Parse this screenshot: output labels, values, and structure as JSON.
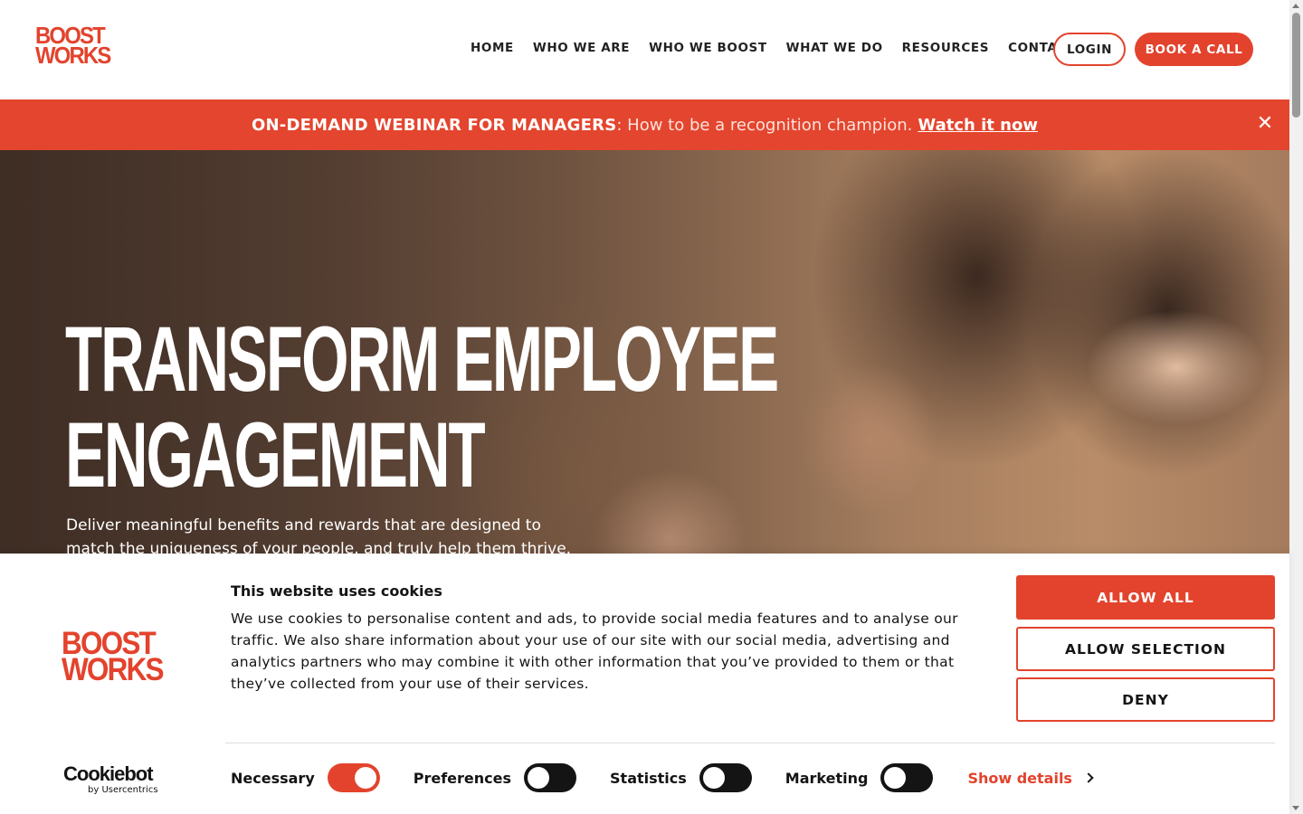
{
  "brand": {
    "logo_line1": "BOOST",
    "logo_line2": "WORKS",
    "accent": "#e3432d"
  },
  "nav": {
    "items": [
      "HOME",
      "WHO WE ARE",
      "WHO WE BOOST",
      "WHAT WE DO",
      "RESOURCES",
      "CONTACT US"
    ],
    "login": "LOGIN",
    "book_call": "BOOK A CALL"
  },
  "banner": {
    "strong": "ON-DEMAND WEBINAR FOR MANAGERS",
    "text": ": How to be a recognition champion.",
    "link": "Watch it now",
    "close_icon": "close-icon"
  },
  "hero": {
    "title_line1": "TRANSFORM EMPLOYEE",
    "title_line2": "ENGAGEMENT",
    "subtitle": "Deliver meaningful benefits and rewards that are designed to match the uniqueness of your people, and truly help them thrive."
  },
  "cookie": {
    "title": "This website uses cookies",
    "text": "We use cookies to personalise content and ads, to provide social media features and to analyse our traffic. We also share information about your use of our site with our social media, advertising and analytics partners who may combine it with other information that you’ve provided to them or that they’ve collected from your use of their services.",
    "allow_all": "ALLOW ALL",
    "allow_selection": "ALLOW SELECTION",
    "deny": "DENY",
    "provider": "Cookiebot",
    "provider_sub": "by Usercentrics",
    "toggles": [
      {
        "label": "Necessary",
        "on": true
      },
      {
        "label": "Preferences",
        "on": false
      },
      {
        "label": "Statistics",
        "on": false
      },
      {
        "label": "Marketing",
        "on": false
      }
    ],
    "show_details": "Show details"
  }
}
